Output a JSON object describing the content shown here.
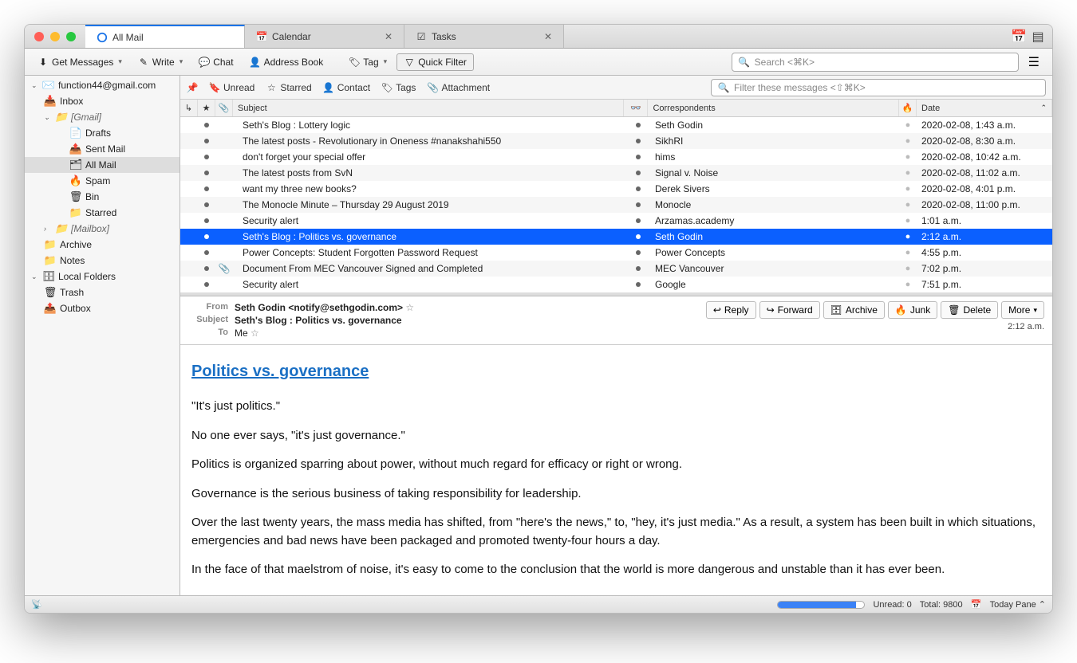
{
  "tabs": [
    {
      "label": "All Mail",
      "active": true
    },
    {
      "label": "Calendar",
      "closable": true
    },
    {
      "label": "Tasks",
      "closable": true
    }
  ],
  "toolbar": {
    "get_messages": "Get Messages",
    "write": "Write",
    "chat": "Chat",
    "address_book": "Address Book",
    "tag": "Tag",
    "quick_filter": "Quick Filter",
    "search_placeholder": "Search <⌘K>"
  },
  "sidebar": {
    "account": "function44@gmail.com",
    "inbox": "Inbox",
    "gmail": "[Gmail]",
    "drafts": "Drafts",
    "sent": "Sent Mail",
    "all_mail": "All Mail",
    "spam": "Spam",
    "bin": "Bin",
    "starred": "Starred",
    "mailbox": "[Mailbox]",
    "archive": "Archive",
    "notes": "Notes",
    "local_folders": "Local Folders",
    "trash": "Trash",
    "outbox": "Outbox"
  },
  "filter_bar": {
    "unread": "Unread",
    "starred": "Starred",
    "contact": "Contact",
    "tags": "Tags",
    "attachment": "Attachment",
    "filter_placeholder": "Filter these messages <⇧⌘K>"
  },
  "columns": {
    "subject": "Subject",
    "correspondents": "Correspondents",
    "date": "Date"
  },
  "messages": [
    {
      "subject": "Seth's Blog : Lottery logic",
      "from": "Seth Godin",
      "date": "2020-02-08, 1:43 a.m.",
      "attach": false
    },
    {
      "subject": "The latest posts - Revolutionary in Oneness #nanakshahi550",
      "from": "SikhRI",
      "date": "2020-02-08, 8:30 a.m.",
      "attach": false
    },
    {
      "subject": "don't forget your special offer",
      "from": "hims",
      "date": "2020-02-08, 10:42 a.m.",
      "attach": false
    },
    {
      "subject": "The latest posts from SvN",
      "from": "Signal v. Noise",
      "date": "2020-02-08, 11:02 a.m.",
      "attach": false
    },
    {
      "subject": "want my three new books?",
      "from": "Derek Sivers",
      "date": "2020-02-08, 4:01 p.m.",
      "attach": false
    },
    {
      "subject": "The Monocle Minute – Thursday 29 August 2019",
      "from": "Monocle",
      "date": "2020-02-08, 11:00 p.m.",
      "attach": false
    },
    {
      "subject": "Security alert",
      "from": "Arzamas.academy",
      "date": "1:01 a.m.",
      "attach": false
    },
    {
      "subject": "Seth's Blog : Politics vs. governance",
      "from": "Seth Godin",
      "date": "2:12 a.m.",
      "attach": false,
      "selected": true
    },
    {
      "subject": "Power Concepts: Student Forgotten Password Request",
      "from": "Power Concepts",
      "date": "4:55 p.m.",
      "attach": false
    },
    {
      "subject": "Document From MEC Vancouver Signed and Completed",
      "from": "MEC Vancouver",
      "date": "7:02 p.m.",
      "attach": true
    },
    {
      "subject": "Security alert",
      "from": "Google",
      "date": "7:51 p.m.",
      "attach": false
    }
  ],
  "reader": {
    "from_label": "From",
    "from_value": "Seth Godin <notify@sethgodin.com>",
    "subject_label": "Subject",
    "subject_value": "Seth's Blog : Politics vs. governance",
    "to_label": "To",
    "to_value": "Me",
    "time": "2:12 a.m.",
    "actions": {
      "reply": "Reply",
      "forward": "Forward",
      "archive": "Archive",
      "junk": "Junk",
      "delete": "Delete",
      "more": "More"
    },
    "title": "Politics vs. governance",
    "p1": "\"It's just politics.\"",
    "p2": "No one ever says, \"it's just governance.\"",
    "p3": "Politics is organized sparring about power, without much regard for efficacy or right or wrong.",
    "p4": "Governance is the serious business of taking responsibility for leadership.",
    "p5": "Over the last twenty years, the mass media has shifted, from \"here's the news,\" to, \"hey, it's just media.\" As a result, a system has been built in which situations, emergencies and bad news have been packaged and promoted twenty-four hours a day.",
    "p6": "In the face of that maelstrom of noise, it's easy to come to the conclusion that the world is more dangerous and unstable than it has ever been."
  },
  "statusbar": {
    "unread": "Unread: 0",
    "total": "Total: 9800",
    "today_pane": "Today Pane"
  }
}
